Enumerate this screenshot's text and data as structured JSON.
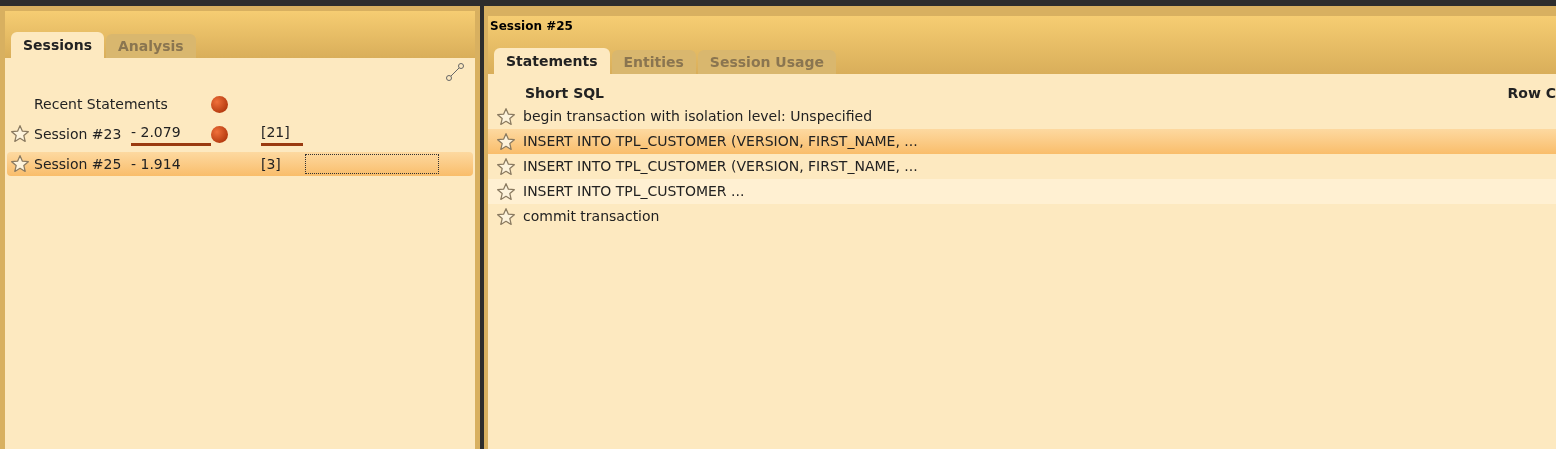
{
  "left_panel": {
    "tabs": [
      {
        "label": "Sessions",
        "selected": true
      },
      {
        "label": "Analysis",
        "selected": false
      }
    ],
    "items": [
      {
        "kind": "header",
        "label": "Recent Statements",
        "indicator": true,
        "selected": false
      },
      {
        "kind": "session",
        "label": "Session #23",
        "duration": "- 2.079",
        "indicator": true,
        "count": "[21]",
        "selected": false
      },
      {
        "kind": "session",
        "label": "Session #25",
        "duration": "- 1.914",
        "indicator": false,
        "count": "[3]",
        "selected": true
      }
    ]
  },
  "right_panel": {
    "title": "Session #25",
    "tabs": [
      {
        "label": "Statements",
        "selected": true
      },
      {
        "label": "Entities",
        "selected": false
      },
      {
        "label": "Session Usage",
        "selected": false
      }
    ],
    "columns": [
      "Short SQL",
      "Row C"
    ],
    "rows": [
      {
        "sql": "begin transaction with isolation level: Unspecified",
        "selected": false
      },
      {
        "sql": "INSERT INTO TPL_CUSTOMER (VERSION, FIRST_NAME, ...",
        "selected": true
      },
      {
        "sql": "INSERT INTO TPL_CUSTOMER (VERSION, FIRST_NAME, ...",
        "selected": false
      },
      {
        "sql": "INSERT INTO TPL_CUSTOMER ...",
        "selected": false
      },
      {
        "sql": "commit transaction",
        "selected": false
      }
    ]
  }
}
